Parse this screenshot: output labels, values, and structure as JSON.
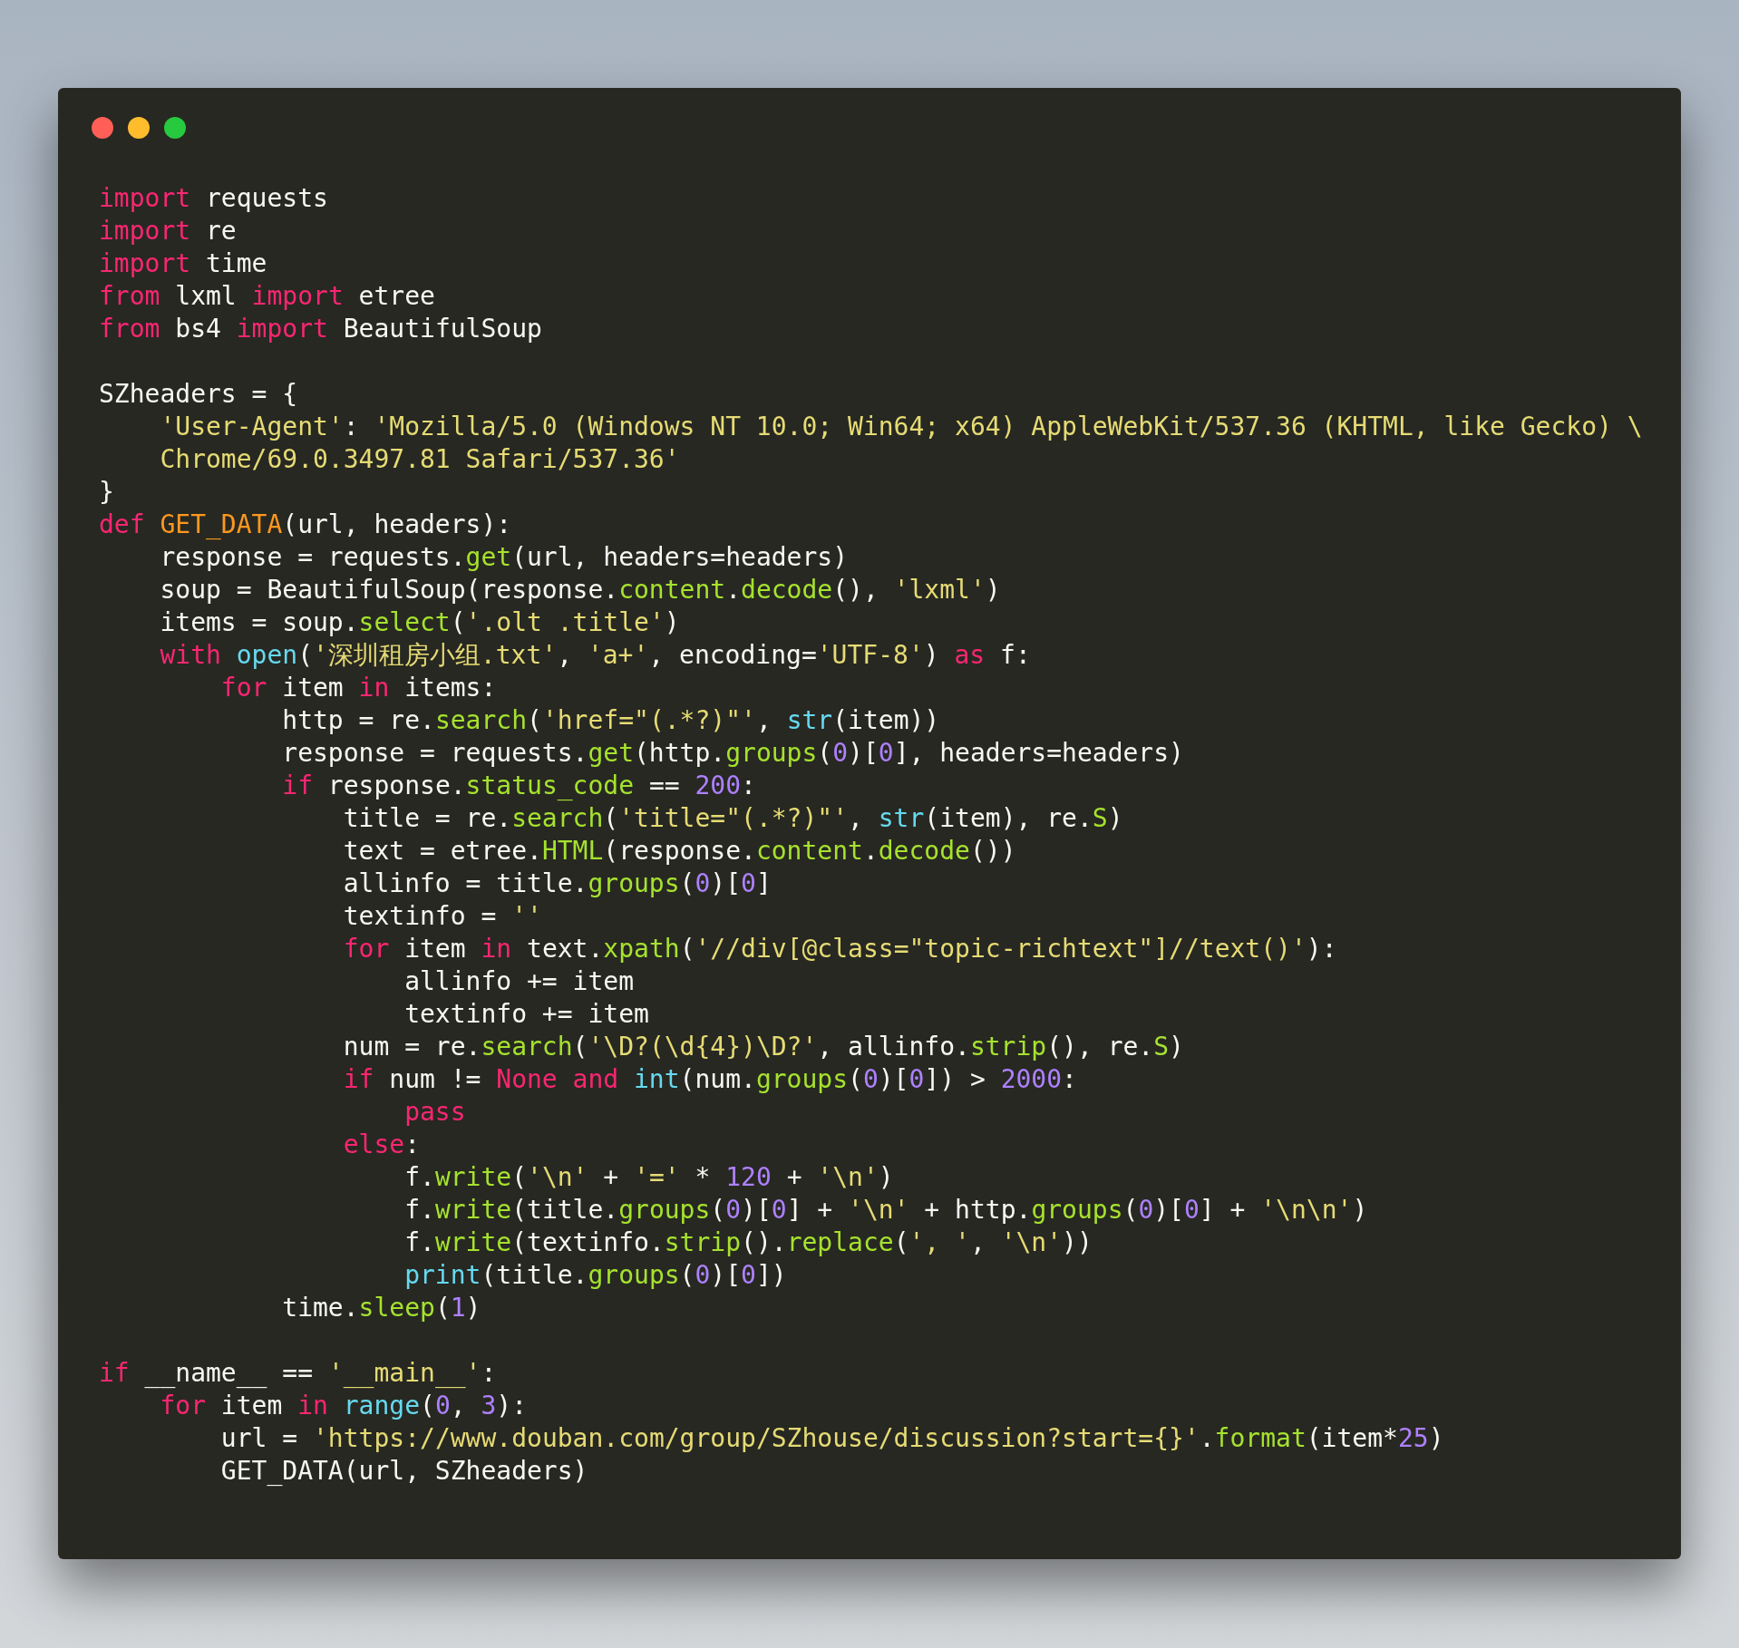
{
  "window": {
    "controls": [
      {
        "color": "#ff5f56"
      },
      {
        "color": "#ffbd2e"
      },
      {
        "color": "#27c93f"
      }
    ]
  },
  "code": {
    "lines": [
      {
        "kind": "code",
        "tokens": [
          {
            "kind": "keyword",
            "text": "import"
          },
          {
            "kind": "plain",
            "text": " requests"
          }
        ]
      },
      {
        "kind": "code",
        "tokens": [
          {
            "kind": "keyword",
            "text": "import"
          },
          {
            "kind": "plain",
            "text": " re"
          }
        ]
      },
      {
        "kind": "code",
        "tokens": [
          {
            "kind": "keyword",
            "text": "import"
          },
          {
            "kind": "plain",
            "text": " time"
          }
        ]
      },
      {
        "kind": "code",
        "tokens": [
          {
            "kind": "keyword",
            "text": "from"
          },
          {
            "kind": "plain",
            "text": " lxml "
          },
          {
            "kind": "keyword",
            "text": "import"
          },
          {
            "kind": "plain",
            "text": " etree"
          }
        ]
      },
      {
        "kind": "code",
        "tokens": [
          {
            "kind": "keyword",
            "text": "from"
          },
          {
            "kind": "plain",
            "text": " bs4 "
          },
          {
            "kind": "keyword",
            "text": "import"
          },
          {
            "kind": "plain",
            "text": " BeautifulSoup"
          }
        ]
      },
      {
        "kind": "blank"
      },
      {
        "kind": "code",
        "tokens": [
          {
            "kind": "plain",
            "text": "SZheaders = {"
          }
        ]
      },
      {
        "kind": "code",
        "tokens": [
          {
            "kind": "string",
            "text": "    'User-Agent'"
          },
          {
            "kind": "plain",
            "text": ": "
          },
          {
            "kind": "string",
            "text": "'Mozilla/5.0 (Windows NT 10.0; Win64; x64) AppleWebKit/537.36 (KHTML, like Gecko) \\"
          }
        ]
      },
      {
        "kind": "code",
        "tokens": [
          {
            "kind": "string",
            "text": "    Chrome/69.0.3497.81 Safari/537.36'"
          }
        ]
      },
      {
        "kind": "code",
        "tokens": [
          {
            "kind": "plain",
            "text": "}"
          }
        ]
      },
      {
        "kind": "code",
        "tokens": [
          {
            "kind": "keyword",
            "text": "def "
          },
          {
            "kind": "defname",
            "text": "GET_DATA"
          },
          {
            "kind": "plain",
            "text": "(url, headers):"
          }
        ]
      },
      {
        "kind": "code",
        "tokens": [
          {
            "kind": "plain",
            "text": "    response = requests."
          },
          {
            "kind": "function",
            "text": "get"
          },
          {
            "kind": "plain",
            "text": "(url, headers=headers)"
          }
        ]
      },
      {
        "kind": "code",
        "tokens": [
          {
            "kind": "plain",
            "text": "    soup = BeautifulSoup(response."
          },
          {
            "kind": "function",
            "text": "content"
          },
          {
            "kind": "plain",
            "text": "."
          },
          {
            "kind": "function",
            "text": "decode"
          },
          {
            "kind": "plain",
            "text": "(), "
          },
          {
            "kind": "string",
            "text": "'lxml'"
          },
          {
            "kind": "plain",
            "text": ")"
          }
        ]
      },
      {
        "kind": "code",
        "tokens": [
          {
            "kind": "plain",
            "text": "    items = soup."
          },
          {
            "kind": "function",
            "text": "select"
          },
          {
            "kind": "plain",
            "text": "("
          },
          {
            "kind": "string",
            "text": "'.olt .title'"
          },
          {
            "kind": "plain",
            "text": ")"
          }
        ]
      },
      {
        "kind": "code",
        "tokens": [
          {
            "kind": "keyword",
            "text": "    with "
          },
          {
            "kind": "builtin",
            "text": "open"
          },
          {
            "kind": "plain",
            "text": "("
          },
          {
            "kind": "string",
            "text": "'深圳租房小组.txt'"
          },
          {
            "kind": "plain",
            "text": ", "
          },
          {
            "kind": "string",
            "text": "'a+'"
          },
          {
            "kind": "plain",
            "text": ", encoding="
          },
          {
            "kind": "string",
            "text": "'UTF-8'"
          },
          {
            "kind": "plain",
            "text": ") "
          },
          {
            "kind": "keyword",
            "text": "as"
          },
          {
            "kind": "plain",
            "text": " f:"
          }
        ]
      },
      {
        "kind": "code",
        "tokens": [
          {
            "kind": "keyword",
            "text": "        for"
          },
          {
            "kind": "plain",
            "text": " item "
          },
          {
            "kind": "keyword",
            "text": "in"
          },
          {
            "kind": "plain",
            "text": " items:"
          }
        ]
      },
      {
        "kind": "code",
        "tokens": [
          {
            "kind": "plain",
            "text": "            http = re."
          },
          {
            "kind": "function",
            "text": "search"
          },
          {
            "kind": "plain",
            "text": "("
          },
          {
            "kind": "string",
            "text": "'href=\"(.*?)\"'"
          },
          {
            "kind": "plain",
            "text": ", "
          },
          {
            "kind": "builtin",
            "text": "str"
          },
          {
            "kind": "plain",
            "text": "(item))"
          }
        ]
      },
      {
        "kind": "code",
        "tokens": [
          {
            "kind": "plain",
            "text": "            response = requests."
          },
          {
            "kind": "function",
            "text": "get"
          },
          {
            "kind": "plain",
            "text": "(http."
          },
          {
            "kind": "function",
            "text": "groups"
          },
          {
            "kind": "plain",
            "text": "("
          },
          {
            "kind": "number",
            "text": "0"
          },
          {
            "kind": "plain",
            "text": ")["
          },
          {
            "kind": "number",
            "text": "0"
          },
          {
            "kind": "plain",
            "text": "], headers=headers)"
          }
        ]
      },
      {
        "kind": "code",
        "tokens": [
          {
            "kind": "keyword",
            "text": "            if"
          },
          {
            "kind": "plain",
            "text": " response."
          },
          {
            "kind": "function",
            "text": "status_code"
          },
          {
            "kind": "plain",
            "text": " == "
          },
          {
            "kind": "number",
            "text": "200"
          },
          {
            "kind": "plain",
            "text": ":"
          }
        ]
      },
      {
        "kind": "code",
        "tokens": [
          {
            "kind": "plain",
            "text": "                title = re."
          },
          {
            "kind": "function",
            "text": "search"
          },
          {
            "kind": "plain",
            "text": "("
          },
          {
            "kind": "string",
            "text": "'title=\"(.*?)\"'"
          },
          {
            "kind": "plain",
            "text": ", "
          },
          {
            "kind": "builtin",
            "text": "str"
          },
          {
            "kind": "plain",
            "text": "(item), re."
          },
          {
            "kind": "function",
            "text": "S"
          },
          {
            "kind": "plain",
            "text": ")"
          }
        ]
      },
      {
        "kind": "code",
        "tokens": [
          {
            "kind": "plain",
            "text": "                text = etree."
          },
          {
            "kind": "function",
            "text": "HTML"
          },
          {
            "kind": "plain",
            "text": "(response."
          },
          {
            "kind": "function",
            "text": "content"
          },
          {
            "kind": "plain",
            "text": "."
          },
          {
            "kind": "function",
            "text": "decode"
          },
          {
            "kind": "plain",
            "text": "())"
          }
        ]
      },
      {
        "kind": "code",
        "tokens": [
          {
            "kind": "plain",
            "text": "                allinfo = title."
          },
          {
            "kind": "function",
            "text": "groups"
          },
          {
            "kind": "plain",
            "text": "("
          },
          {
            "kind": "number",
            "text": "0"
          },
          {
            "kind": "plain",
            "text": ")["
          },
          {
            "kind": "number",
            "text": "0"
          },
          {
            "kind": "plain",
            "text": "]"
          }
        ]
      },
      {
        "kind": "code",
        "tokens": [
          {
            "kind": "plain",
            "text": "                textinfo = "
          },
          {
            "kind": "string",
            "text": "''"
          }
        ]
      },
      {
        "kind": "code",
        "tokens": [
          {
            "kind": "keyword",
            "text": "                for"
          },
          {
            "kind": "plain",
            "text": " item "
          },
          {
            "kind": "keyword",
            "text": "in"
          },
          {
            "kind": "plain",
            "text": " text."
          },
          {
            "kind": "function",
            "text": "xpath"
          },
          {
            "kind": "plain",
            "text": "("
          },
          {
            "kind": "string",
            "text": "'//div[@class=\"topic-richtext\"]//text()'"
          },
          {
            "kind": "plain",
            "text": "):"
          }
        ]
      },
      {
        "kind": "code",
        "tokens": [
          {
            "kind": "plain",
            "text": "                    allinfo += item"
          }
        ]
      },
      {
        "kind": "code",
        "tokens": [
          {
            "kind": "plain",
            "text": "                    textinfo += item"
          }
        ]
      },
      {
        "kind": "code",
        "tokens": [
          {
            "kind": "plain",
            "text": "                num = re."
          },
          {
            "kind": "function",
            "text": "search"
          },
          {
            "kind": "plain",
            "text": "("
          },
          {
            "kind": "string",
            "text": "'\\D?(\\d{4})\\D?'"
          },
          {
            "kind": "plain",
            "text": ", allinfo."
          },
          {
            "kind": "function",
            "text": "strip"
          },
          {
            "kind": "plain",
            "text": "(), re."
          },
          {
            "kind": "function",
            "text": "S"
          },
          {
            "kind": "plain",
            "text": ")"
          }
        ]
      },
      {
        "kind": "code",
        "tokens": [
          {
            "kind": "keyword",
            "text": "                if"
          },
          {
            "kind": "plain",
            "text": " num != "
          },
          {
            "kind": "keyword",
            "text": "None and "
          },
          {
            "kind": "builtin",
            "text": "int"
          },
          {
            "kind": "plain",
            "text": "(num."
          },
          {
            "kind": "function",
            "text": "groups"
          },
          {
            "kind": "plain",
            "text": "("
          },
          {
            "kind": "number",
            "text": "0"
          },
          {
            "kind": "plain",
            "text": ")["
          },
          {
            "kind": "number",
            "text": "0"
          },
          {
            "kind": "plain",
            "text": "]) > "
          },
          {
            "kind": "number",
            "text": "2000"
          },
          {
            "kind": "plain",
            "text": ":"
          }
        ]
      },
      {
        "kind": "code",
        "tokens": [
          {
            "kind": "keyword",
            "text": "                    pass"
          }
        ]
      },
      {
        "kind": "code",
        "tokens": [
          {
            "kind": "keyword",
            "text": "                else"
          },
          {
            "kind": "plain",
            "text": ":"
          }
        ]
      },
      {
        "kind": "code",
        "tokens": [
          {
            "kind": "plain",
            "text": "                    f."
          },
          {
            "kind": "function",
            "text": "write"
          },
          {
            "kind": "plain",
            "text": "("
          },
          {
            "kind": "string",
            "text": "'\\n'"
          },
          {
            "kind": "plain",
            "text": " + "
          },
          {
            "kind": "string",
            "text": "'='"
          },
          {
            "kind": "plain",
            "text": " * "
          },
          {
            "kind": "number",
            "text": "120"
          },
          {
            "kind": "plain",
            "text": " + "
          },
          {
            "kind": "string",
            "text": "'\\n'"
          },
          {
            "kind": "plain",
            "text": ")"
          }
        ]
      },
      {
        "kind": "code",
        "tokens": [
          {
            "kind": "plain",
            "text": "                    f."
          },
          {
            "kind": "function",
            "text": "write"
          },
          {
            "kind": "plain",
            "text": "(title."
          },
          {
            "kind": "function",
            "text": "groups"
          },
          {
            "kind": "plain",
            "text": "("
          },
          {
            "kind": "number",
            "text": "0"
          },
          {
            "kind": "plain",
            "text": ")["
          },
          {
            "kind": "number",
            "text": "0"
          },
          {
            "kind": "plain",
            "text": "] + "
          },
          {
            "kind": "string",
            "text": "'\\n'"
          },
          {
            "kind": "plain",
            "text": " + http."
          },
          {
            "kind": "function",
            "text": "groups"
          },
          {
            "kind": "plain",
            "text": "("
          },
          {
            "kind": "number",
            "text": "0"
          },
          {
            "kind": "plain",
            "text": ")["
          },
          {
            "kind": "number",
            "text": "0"
          },
          {
            "kind": "plain",
            "text": "] + "
          },
          {
            "kind": "string",
            "text": "'\\n\\n'"
          },
          {
            "kind": "plain",
            "text": ")"
          }
        ]
      },
      {
        "kind": "code",
        "tokens": [
          {
            "kind": "plain",
            "text": "                    f."
          },
          {
            "kind": "function",
            "text": "write"
          },
          {
            "kind": "plain",
            "text": "(textinfo."
          },
          {
            "kind": "function",
            "text": "strip"
          },
          {
            "kind": "plain",
            "text": "()."
          },
          {
            "kind": "function",
            "text": "replace"
          },
          {
            "kind": "plain",
            "text": "("
          },
          {
            "kind": "string",
            "text": "', '"
          },
          {
            "kind": "plain",
            "text": ", "
          },
          {
            "kind": "string",
            "text": "'\\n'"
          },
          {
            "kind": "plain",
            "text": "))"
          }
        ]
      },
      {
        "kind": "code",
        "tokens": [
          {
            "kind": "builtin",
            "text": "                    print"
          },
          {
            "kind": "plain",
            "text": "(title."
          },
          {
            "kind": "function",
            "text": "groups"
          },
          {
            "kind": "plain",
            "text": "("
          },
          {
            "kind": "number",
            "text": "0"
          },
          {
            "kind": "plain",
            "text": ")["
          },
          {
            "kind": "number",
            "text": "0"
          },
          {
            "kind": "plain",
            "text": "])"
          }
        ]
      },
      {
        "kind": "code",
        "tokens": [
          {
            "kind": "plain",
            "text": "            time."
          },
          {
            "kind": "function",
            "text": "sleep"
          },
          {
            "kind": "plain",
            "text": "("
          },
          {
            "kind": "number",
            "text": "1"
          },
          {
            "kind": "plain",
            "text": ")"
          }
        ]
      },
      {
        "kind": "blank"
      },
      {
        "kind": "code",
        "tokens": [
          {
            "kind": "keyword",
            "text": "if"
          },
          {
            "kind": "plain",
            "text": " __name__ == "
          },
          {
            "kind": "string",
            "text": "'__main__'"
          },
          {
            "kind": "plain",
            "text": ":"
          }
        ]
      },
      {
        "kind": "code",
        "tokens": [
          {
            "kind": "keyword",
            "text": "    for"
          },
          {
            "kind": "plain",
            "text": " item "
          },
          {
            "kind": "keyword",
            "text": "in "
          },
          {
            "kind": "builtin",
            "text": "range"
          },
          {
            "kind": "plain",
            "text": "("
          },
          {
            "kind": "number",
            "text": "0"
          },
          {
            "kind": "plain",
            "text": ", "
          },
          {
            "kind": "number",
            "text": "3"
          },
          {
            "kind": "plain",
            "text": "):"
          }
        ]
      },
      {
        "kind": "code",
        "tokens": [
          {
            "kind": "plain",
            "text": "        url = "
          },
          {
            "kind": "string",
            "text": "'https://www.douban.com/group/SZhouse/discussion?start={}'"
          },
          {
            "kind": "plain",
            "text": "."
          },
          {
            "kind": "function",
            "text": "format"
          },
          {
            "kind": "plain",
            "text": "(item*"
          },
          {
            "kind": "number",
            "text": "25"
          },
          {
            "kind": "plain",
            "text": ")"
          }
        ]
      },
      {
        "kind": "code",
        "tokens": [
          {
            "kind": "plain",
            "text": "        GET_DATA(url, SZheaders)"
          }
        ]
      }
    ]
  }
}
